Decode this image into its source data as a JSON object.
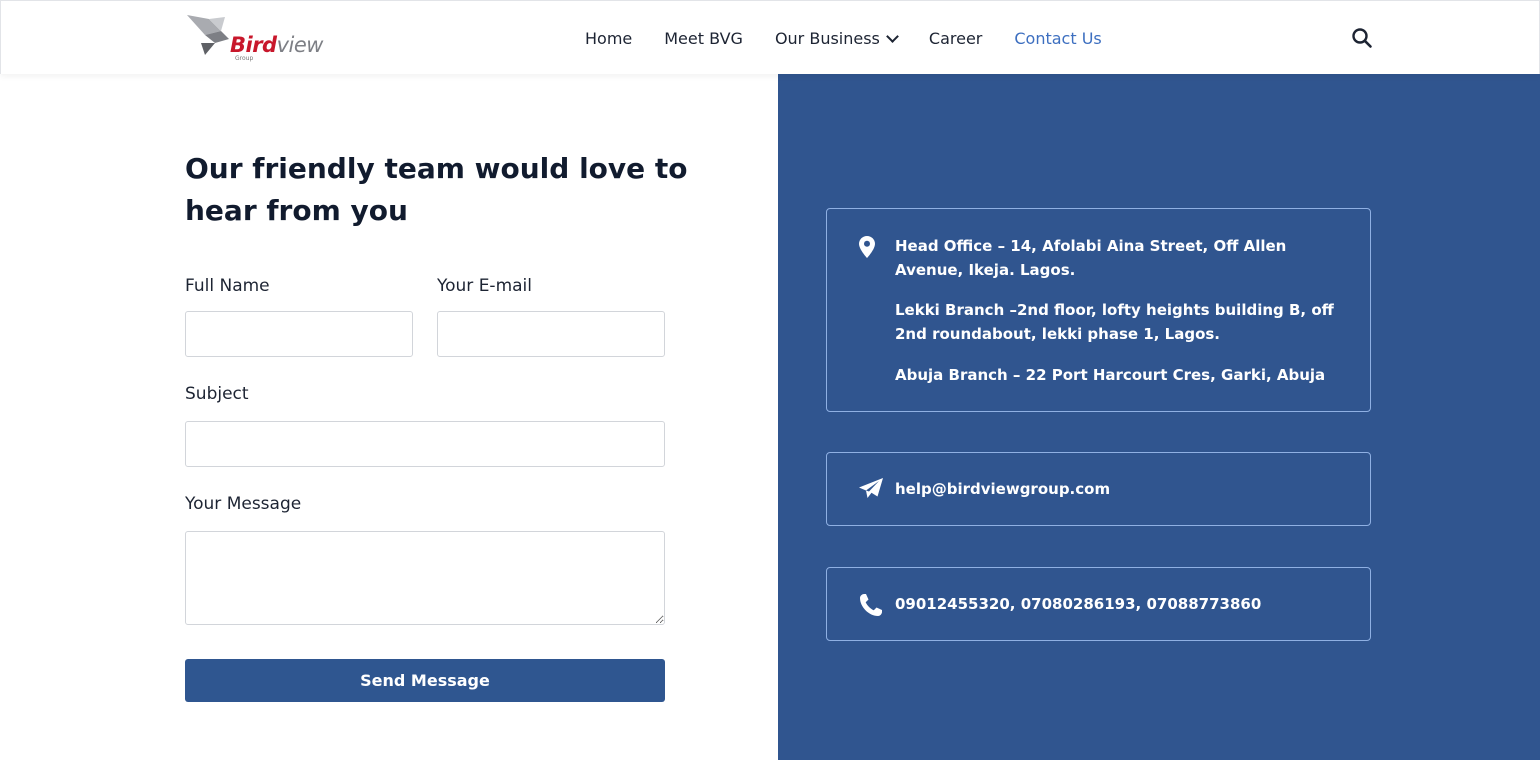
{
  "header": {
    "logo": {
      "word_red": "Bird",
      "word_gray": "view",
      "tagline": "Group"
    },
    "nav": [
      {
        "label": "Home"
      },
      {
        "label": "Meet BVG"
      },
      {
        "label": "Our Business"
      },
      {
        "label": "Career"
      },
      {
        "label": "Contact Us"
      }
    ],
    "active_nav": "Contact Us",
    "search_icon": "search-icon"
  },
  "form": {
    "heading": "Our friendly team would love to hear from you",
    "full_name_label": "Full Name",
    "full_name_value": "",
    "email_label": "Your E-mail",
    "email_value": "",
    "subject_label": "Subject",
    "subject_value": "",
    "message_label": "Your Message",
    "message_value": "",
    "send_label": "Send Message"
  },
  "contact": {
    "addresses": [
      "Head Office – 14, Afolabi Aina Street, Off Allen Avenue, Ikeja. Lagos.",
      "Lekki Branch –2nd floor, lofty heights building B, off 2nd roundabout, lekki phase 1, Lagos.",
      "Abuja Branch – 22 Port Harcourt Cres, Garki, Abuja"
    ],
    "email": "help@birdviewgroup.com",
    "phones": "09012455320, 07080286193, 07088773860"
  },
  "colors": {
    "accent": "#30558f",
    "button": "#2f5690",
    "active_nav": "#3d6fc0",
    "logo_red": "#c8172b"
  },
  "icons": [
    "map-marker-icon",
    "paper-plane-icon",
    "phone-icon",
    "search-icon",
    "chevron-down-icon"
  ]
}
